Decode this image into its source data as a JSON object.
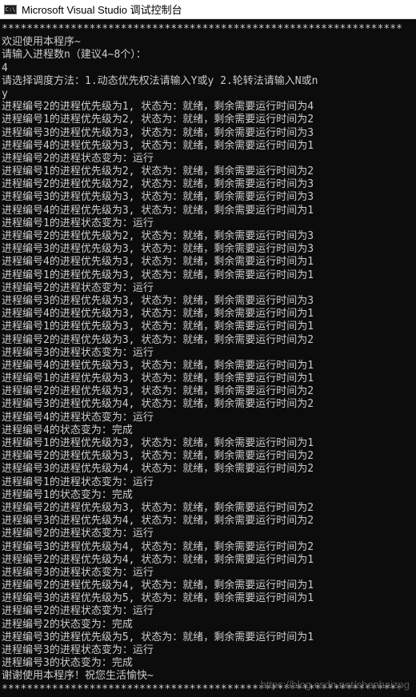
{
  "window": {
    "icon": "console-app-icon",
    "icon_glyph": "C:\\",
    "title": "Microsoft Visual Studio 调试控制台"
  },
  "console": {
    "lines": [
      "****************************************************************",
      "欢迎使用本程序~",
      "请输入进程数n（建议4~8个）：",
      "4",
      "请选择调度方法：1.动态优先权法请输入Y或y 2.轮转法请输入N或n",
      "y",
      "进程编号2的进程优先级为1, 状态为：就绪，剩余需要运行时间为4",
      "进程编号1的进程优先级为2, 状态为：就绪，剩余需要运行时间为2",
      "进程编号3的进程优先级为3, 状态为：就绪，剩余需要运行时间为3",
      "进程编号4的进程优先级为3, 状态为：就绪，剩余需要运行时间为1",
      "进程编号2的进程状态变为：运行",
      "进程编号1的进程优先级为2, 状态为：就绪，剩余需要运行时间为2",
      "进程编号2的进程优先级为2, 状态为：就绪，剩余需要运行时间为3",
      "进程编号3的进程优先级为3, 状态为：就绪，剩余需要运行时间为3",
      "进程编号4的进程优先级为3, 状态为：就绪，剩余需要运行时间为1",
      "进程编号1的进程状态变为：运行",
      "进程编号2的进程优先级为2, 状态为：就绪，剩余需要运行时间为3",
      "进程编号3的进程优先级为3, 状态为：就绪，剩余需要运行时间为3",
      "进程编号4的进程优先级为3, 状态为：就绪，剩余需要运行时间为1",
      "进程编号1的进程优先级为3, 状态为：就绪，剩余需要运行时间为1",
      "进程编号2的进程状态变为：运行",
      "进程编号3的进程优先级为3, 状态为：就绪，剩余需要运行时间为3",
      "进程编号4的进程优先级为3, 状态为：就绪，剩余需要运行时间为1",
      "进程编号1的进程优先级为3, 状态为：就绪，剩余需要运行时间为1",
      "进程编号2的进程优先级为3, 状态为：就绪，剩余需要运行时间为2",
      "进程编号3的进程状态变为：运行",
      "进程编号4的进程优先级为3, 状态为：就绪，剩余需要运行时间为1",
      "进程编号1的进程优先级为3, 状态为：就绪，剩余需要运行时间为1",
      "进程编号2的进程优先级为3, 状态为：就绪，剩余需要运行时间为2",
      "进程编号3的进程优先级为4, 状态为：就绪，剩余需要运行时间为2",
      "进程编号4的进程状态变为：运行",
      "进程编号4的状态变为：完成",
      "进程编号1的进程优先级为3, 状态为：就绪，剩余需要运行时间为1",
      "进程编号2的进程优先级为3, 状态为：就绪，剩余需要运行时间为2",
      "进程编号3的进程优先级为4, 状态为：就绪，剩余需要运行时间为2",
      "进程编号1的进程状态变为：运行",
      "进程编号1的状态变为：完成",
      "进程编号2的进程优先级为3, 状态为：就绪，剩余需要运行时间为2",
      "进程编号3的进程优先级为4, 状态为：就绪，剩余需要运行时间为2",
      "进程编号2的进程状态变为：运行",
      "进程编号3的进程优先级为4, 状态为：就绪，剩余需要运行时间为2",
      "进程编号2的进程优先级为4, 状态为：就绪，剩余需要运行时间为1",
      "进程编号3的进程状态变为：运行",
      "进程编号2的进程优先级为4, 状态为：就绪，剩余需要运行时间为1",
      "进程编号3的进程优先级为5, 状态为：就绪，剩余需要运行时间为1",
      "进程编号2的进程状态变为：运行",
      "进程编号2的状态变为：完成",
      "进程编号3的进程优先级为5, 状态为：就绪，剩余需要运行时间为1",
      "进程编号3的进程状态变为：运行",
      "进程编号3的状态变为：完成",
      "谢谢使用本程序！祝您生活愉快~",
      "****************************************************************"
    ]
  },
  "watermark": "https://blog.csdn.net/shenhaizpg"
}
